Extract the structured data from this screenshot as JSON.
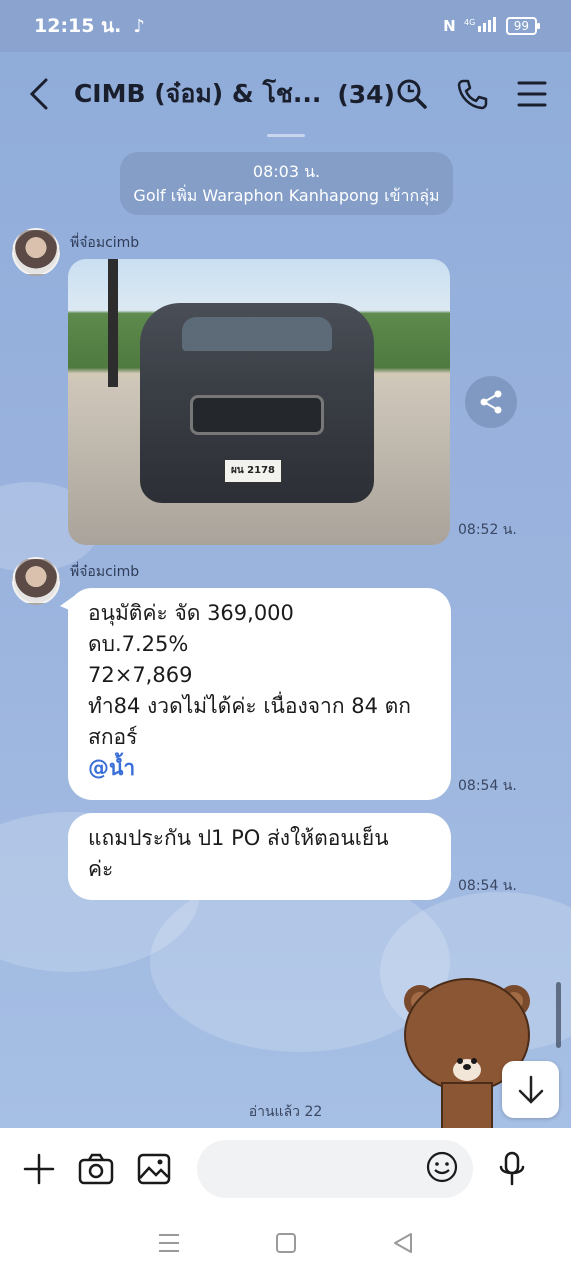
{
  "status_bar": {
    "time": "12:15 น.",
    "signal": "⁴ᴳ",
    "battery": "99"
  },
  "header": {
    "title": "CIMB (จ๋อม) & โช...",
    "member_count": "(34)"
  },
  "system_message": {
    "time": "08:03 น.",
    "text": "Golf เพิ่ม Waraphon Kanhapong เข้ากลุ่ม"
  },
  "messages": [
    {
      "sender": "พี่จ๋อมcimb",
      "type": "image",
      "plate": "ผน 2178",
      "time": "08:52 น."
    },
    {
      "sender": "พี่จ๋อมcimb",
      "type": "text",
      "lines": [
        "อนุมัติค่ะ จัด 369,000",
        "ดบ.7.25%",
        "72×7,869",
        "ทำ84 งวดไม่ได้ค่ะ เนื่องจาก 84 ตก",
        "สกอร์"
      ],
      "mention": "@น้ำ",
      "time": "08:54 น."
    },
    {
      "type": "text",
      "lines": [
        "แถมประกัน ป1 PO ส่งให้ตอนเย็น",
        "ค่ะ"
      ],
      "time": "08:54 น."
    }
  ],
  "read_receipt": "อ่านแล้ว 22",
  "input": {
    "placeholder": ""
  },
  "icons": {
    "back": "chevron-left-icon",
    "search": "search-icon",
    "call": "phone-icon",
    "menu": "menu-icon",
    "share": "share-icon",
    "scroll_down": "arrow-down-icon",
    "add": "plus-icon",
    "camera": "camera-icon",
    "gallery": "image-icon",
    "emoji": "smiley-icon",
    "mic": "microphone-icon"
  }
}
